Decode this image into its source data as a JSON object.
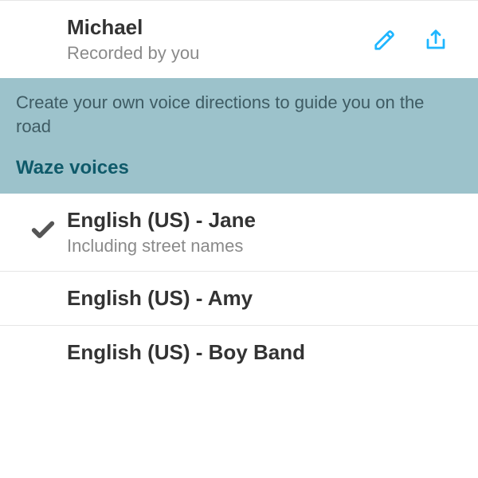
{
  "myvoice": {
    "name": "Michael",
    "subtitle": "Recorded by you"
  },
  "banner": {
    "text": "Create your own voice directions to guide you on the road",
    "section_label": "Waze voices"
  },
  "voices": [
    {
      "name": "English (US) - Jane",
      "subtitle": "Including street names",
      "selected": true
    },
    {
      "name": "English (US) - Amy",
      "subtitle": "",
      "selected": false
    },
    {
      "name": "English (US) - Boy Band",
      "subtitle": "",
      "selected": false
    }
  ],
  "colors": {
    "accent": "#1fb6ff",
    "banner": "#9cc2cb",
    "teal_text": "#0f5a6a"
  }
}
